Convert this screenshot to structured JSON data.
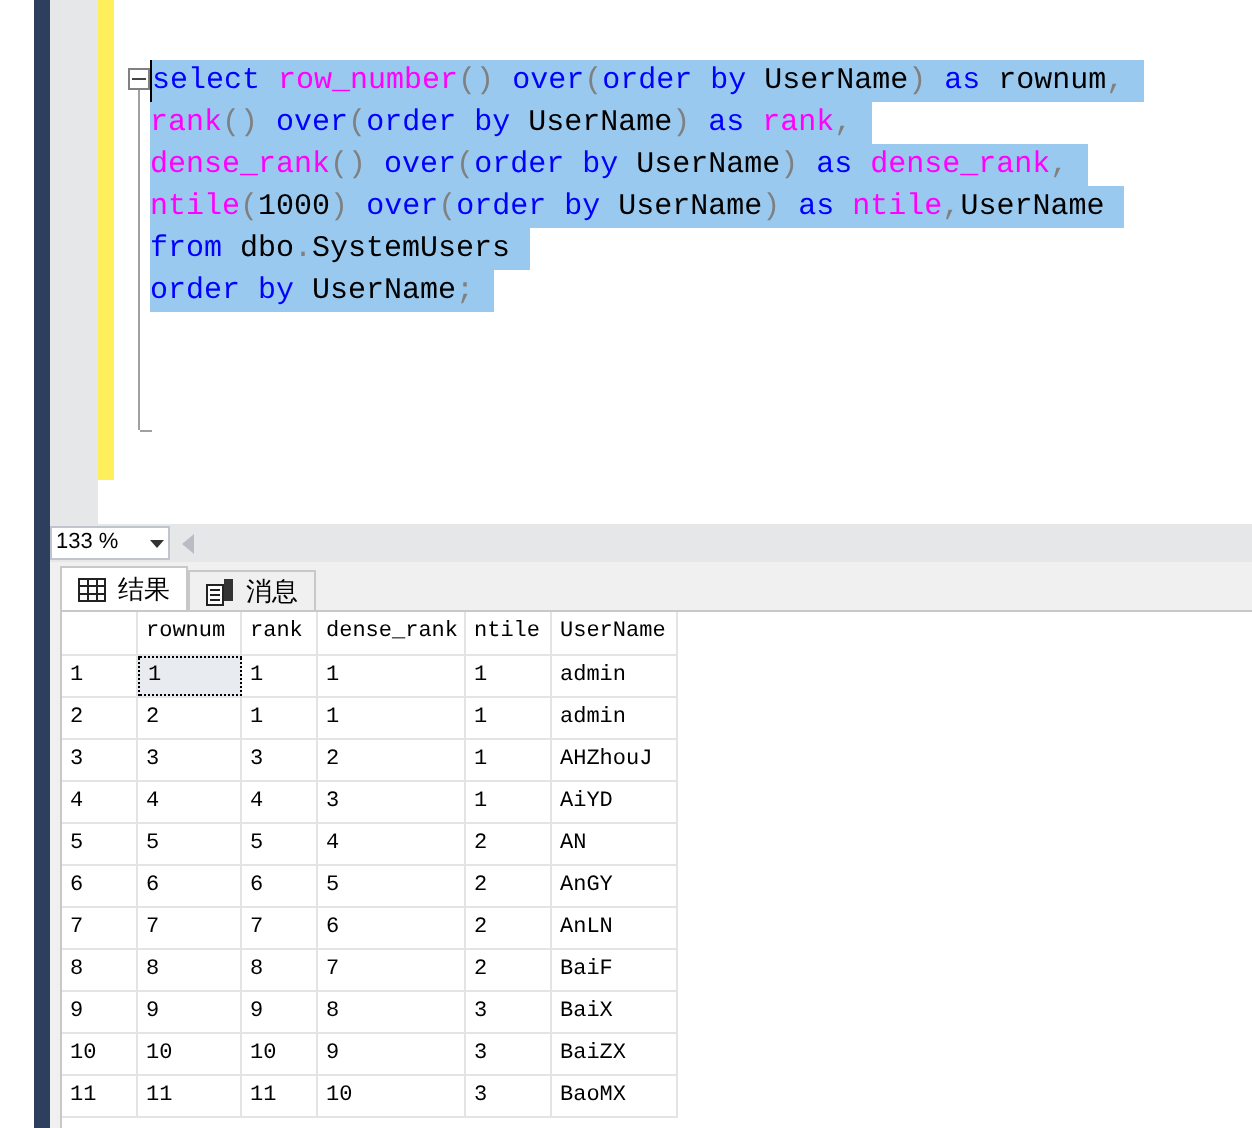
{
  "editor": {
    "lines": [
      {
        "selected": true,
        "tokens": [
          {
            "kind": "kw",
            "text": "select"
          },
          {
            "kind": "fn",
            "text": " row_number"
          },
          {
            "kind": "op",
            "text": "()"
          },
          {
            "kind": "kw",
            "text": " over"
          },
          {
            "kind": "op",
            "text": "("
          },
          {
            "kind": "kw",
            "text": "order by"
          },
          {
            "kind": "id",
            "text": " UserName"
          },
          {
            "kind": "op",
            "text": ")"
          },
          {
            "kind": "kw",
            "text": " as"
          },
          {
            "kind": "id",
            "text": " rownum"
          },
          {
            "kind": "op",
            "text": ","
          }
        ]
      },
      {
        "selected": true,
        "tokens": [
          {
            "kind": "fn",
            "text": "rank"
          },
          {
            "kind": "op",
            "text": "()"
          },
          {
            "kind": "kw",
            "text": " over"
          },
          {
            "kind": "op",
            "text": "("
          },
          {
            "kind": "kw",
            "text": "order by"
          },
          {
            "kind": "id",
            "text": " UserName"
          },
          {
            "kind": "op",
            "text": ")"
          },
          {
            "kind": "kw",
            "text": " as"
          },
          {
            "kind": "fn",
            "text": " rank"
          },
          {
            "kind": "op",
            "text": ","
          }
        ]
      },
      {
        "selected": true,
        "tokens": [
          {
            "kind": "fn",
            "text": "dense_rank"
          },
          {
            "kind": "op",
            "text": "()"
          },
          {
            "kind": "kw",
            "text": " over"
          },
          {
            "kind": "op",
            "text": "("
          },
          {
            "kind": "kw",
            "text": "order by"
          },
          {
            "kind": "id",
            "text": " UserName"
          },
          {
            "kind": "op",
            "text": ")"
          },
          {
            "kind": "kw",
            "text": " as"
          },
          {
            "kind": "fn",
            "text": " dense_rank"
          },
          {
            "kind": "op",
            "text": ","
          }
        ]
      },
      {
        "selected": true,
        "tokens": [
          {
            "kind": "fn",
            "text": "ntile"
          },
          {
            "kind": "op",
            "text": "("
          },
          {
            "kind": "id",
            "text": "1000"
          },
          {
            "kind": "op",
            "text": ")"
          },
          {
            "kind": "kw",
            "text": " over"
          },
          {
            "kind": "op",
            "text": "("
          },
          {
            "kind": "kw",
            "text": "order by"
          },
          {
            "kind": "id",
            "text": " UserName"
          },
          {
            "kind": "op",
            "text": ")"
          },
          {
            "kind": "kw",
            "text": " as"
          },
          {
            "kind": "fn",
            "text": " ntile"
          },
          {
            "kind": "op",
            "text": ","
          },
          {
            "kind": "id",
            "text": "UserName"
          }
        ]
      },
      {
        "selected": true,
        "tokens": [
          {
            "kind": "kw",
            "text": "from"
          },
          {
            "kind": "id",
            "text": " dbo"
          },
          {
            "kind": "op",
            "text": "."
          },
          {
            "kind": "id",
            "text": "SystemUsers"
          }
        ]
      },
      {
        "selected": true,
        "tokens": [
          {
            "kind": "kw",
            "text": "order by"
          },
          {
            "kind": "id",
            "text": " UserName"
          },
          {
            "kind": "op",
            "text": ";"
          }
        ]
      }
    ]
  },
  "zoom": {
    "value": "133 %"
  },
  "tabs": [
    {
      "label": "结果",
      "selected": true,
      "kind": "grid"
    },
    {
      "label": "消息",
      "selected": false,
      "kind": "messages"
    }
  ],
  "grid": {
    "columns": [
      "rownum",
      "rank",
      "dense_rank",
      "ntile",
      "UserName"
    ],
    "rows": [
      {
        "header": "1",
        "focused": true,
        "cells": [
          "1",
          "1",
          "1",
          "1",
          "admin"
        ]
      },
      {
        "header": "2",
        "focused": false,
        "cells": [
          "2",
          "1",
          "1",
          "1",
          "admin"
        ]
      },
      {
        "header": "3",
        "focused": false,
        "cells": [
          "3",
          "3",
          "2",
          "1",
          "AHZhouJ"
        ]
      },
      {
        "header": "4",
        "focused": false,
        "cells": [
          "4",
          "4",
          "3",
          "1",
          "AiYD"
        ]
      },
      {
        "header": "5",
        "focused": false,
        "cells": [
          "5",
          "5",
          "4",
          "2",
          "AN"
        ]
      },
      {
        "header": "6",
        "focused": false,
        "cells": [
          "6",
          "6",
          "5",
          "2",
          "AnGY"
        ]
      },
      {
        "header": "7",
        "focused": false,
        "cells": [
          "7",
          "7",
          "6",
          "2",
          "AnLN"
        ]
      },
      {
        "header": "8",
        "focused": false,
        "cells": [
          "8",
          "8",
          "7",
          "2",
          "BaiF"
        ]
      },
      {
        "header": "9",
        "focused": false,
        "cells": [
          "9",
          "9",
          "8",
          "3",
          "BaiX"
        ]
      },
      {
        "header": "10",
        "focused": false,
        "cells": [
          "10",
          "10",
          "9",
          "3",
          "BaiZX"
        ]
      },
      {
        "header": "11",
        "focused": false,
        "cells": [
          "11",
          "11",
          "10",
          "3",
          "BaoMX"
        ]
      }
    ]
  }
}
